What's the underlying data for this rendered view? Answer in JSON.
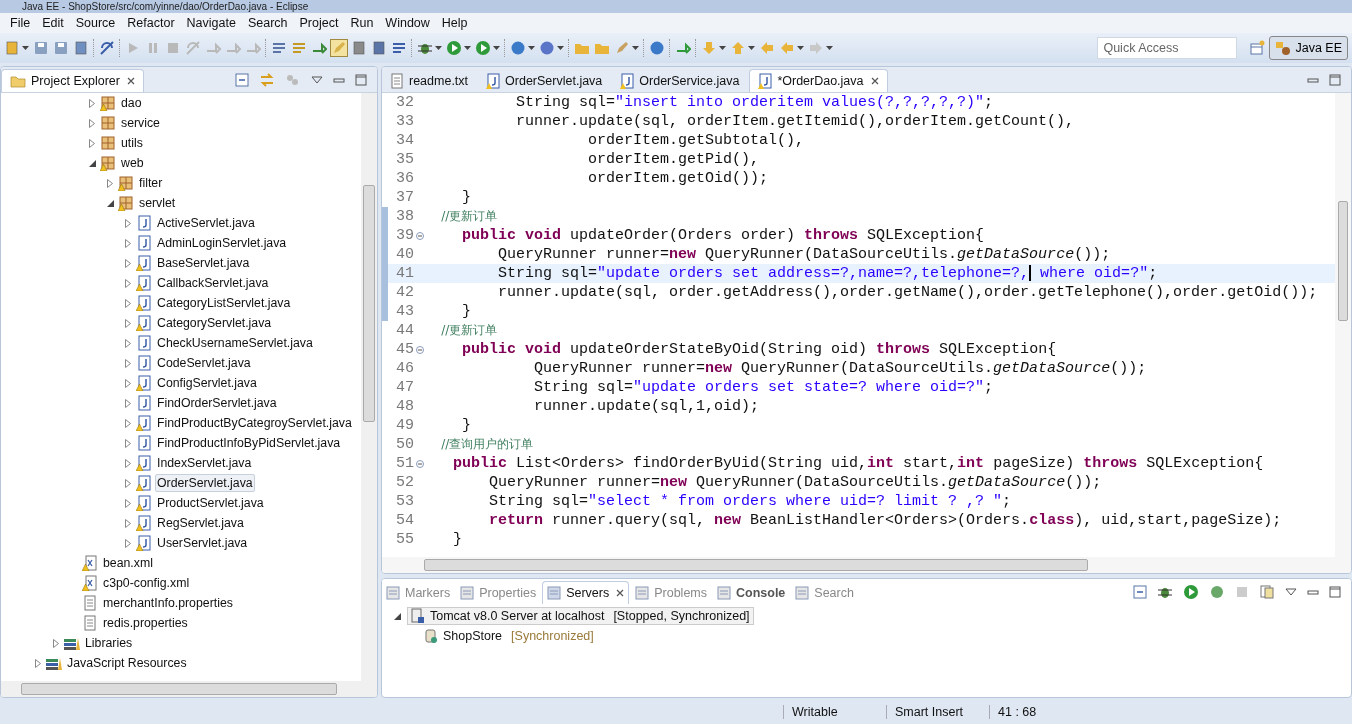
{
  "window": {
    "title": "Java EE - ShopStore/src/com/yinne/dao/OrderDao.java - Eclipse"
  },
  "menu": [
    "File",
    "Edit",
    "Source",
    "Refactor",
    "Navigate",
    "Search",
    "Project",
    "Run",
    "Window",
    "Help"
  ],
  "quick_access": {
    "placeholder": "Quick Access"
  },
  "perspective": {
    "label": "Java EE",
    "selected": true
  },
  "explorer": {
    "title": "Project Explorer",
    "tree": [
      {
        "children": [
          {
            "children": [
              {
                "children": [
                  {
                    "label": "dao",
                    "kind": "package",
                    "warning": true,
                    "expanded": false,
                    "selected": false
                  },
                  {
                    "label": "service",
                    "kind": "package",
                    "warning": false,
                    "expanded": false,
                    "selected": false
                  },
                  {
                    "label": "utils",
                    "kind": "package",
                    "warning": false,
                    "expanded": false,
                    "selected": false
                  },
                  {
                    "label": "web",
                    "kind": "package",
                    "warning": true,
                    "expanded": true,
                    "selected": false,
                    "children": [
                      {
                        "label": "filter",
                        "kind": "package",
                        "warning": true,
                        "expanded": false,
                        "selected": false
                      },
                      {
                        "label": "servlet",
                        "kind": "package",
                        "warning": true,
                        "expanded": true,
                        "selected": false,
                        "children": [
                          {
                            "label": "ActiveServlet.java",
                            "kind": "java",
                            "warning": false,
                            "expanded": false,
                            "selected": false
                          },
                          {
                            "label": "AdminLoginServlet.java",
                            "kind": "java",
                            "warning": false,
                            "expanded": false,
                            "selected": false
                          },
                          {
                            "label": "BaseServlet.java",
                            "kind": "java",
                            "warning": true,
                            "expanded": false,
                            "selected": false
                          },
                          {
                            "label": "CallbackServlet.java",
                            "kind": "java",
                            "warning": true,
                            "expanded": false,
                            "selected": false
                          },
                          {
                            "label": "CategoryListServlet.java",
                            "kind": "java",
                            "warning": true,
                            "expanded": false,
                            "selected": false
                          },
                          {
                            "label": "CategoryServlet.java",
                            "kind": "java",
                            "warning": true,
                            "expanded": false,
                            "selected": false
                          },
                          {
                            "label": "CheckUsernameServlet.java",
                            "kind": "java",
                            "warning": false,
                            "expanded": false,
                            "selected": false
                          },
                          {
                            "label": "CodeServlet.java",
                            "kind": "java",
                            "warning": false,
                            "expanded": false,
                            "selected": false
                          },
                          {
                            "label": "ConfigServlet.java",
                            "kind": "java",
                            "warning": true,
                            "expanded": false,
                            "selected": false
                          },
                          {
                            "label": "FindOrderServlet.java",
                            "kind": "java",
                            "warning": false,
                            "expanded": false,
                            "selected": false
                          },
                          {
                            "label": "FindProductByCategroyServlet.java",
                            "kind": "java",
                            "warning": true,
                            "expanded": false,
                            "selected": false
                          },
                          {
                            "label": "FindProductInfoByPidServlet.java",
                            "kind": "java",
                            "warning": false,
                            "expanded": false,
                            "selected": false
                          },
                          {
                            "label": "IndexServlet.java",
                            "kind": "java",
                            "warning": true,
                            "expanded": false,
                            "selected": false
                          },
                          {
                            "label": "OrderServlet.java",
                            "kind": "java",
                            "warning": true,
                            "expanded": false,
                            "selected": true
                          },
                          {
                            "label": "ProductServlet.java",
                            "kind": "java",
                            "warning": true,
                            "expanded": false,
                            "selected": false
                          },
                          {
                            "label": "RegServlet.java",
                            "kind": "java",
                            "warning": true,
                            "expanded": false,
                            "selected": false
                          },
                          {
                            "label": "UserServlet.java",
                            "kind": "java",
                            "warning": true,
                            "expanded": false,
                            "selected": false
                          }
                        ]
                      }
                    ]
                  }
                ]
              },
              {
                "label": "bean.xml",
                "kind": "xml",
                "warning": true,
                "selected": false
              },
              {
                "label": "c3p0-config.xml",
                "kind": "xml",
                "warning": true,
                "selected": false
              },
              {
                "label": "merchantInfo.properties",
                "kind": "file",
                "warning": false,
                "selected": false
              },
              {
                "label": "redis.properties",
                "kind": "file",
                "warning": false,
                "selected": false
              }
            ]
          },
          {
            "label": "Libraries",
            "kind": "library",
            "warning": false,
            "expanded": false,
            "selected": false
          }
        ]
      },
      {
        "label": "JavaScript Resources",
        "kind": "library",
        "warning": false,
        "expanded": false,
        "selected": false
      }
    ]
  },
  "editor_tabs": [
    {
      "label": "readme.txt",
      "kind": "text",
      "selected": false
    },
    {
      "label": "OrderServlet.java",
      "kind": "java",
      "selected": false
    },
    {
      "label": "OrderService.java",
      "kind": "java",
      "selected": false
    },
    {
      "label": "*OrderDao.java",
      "kind": "java",
      "selected": true
    }
  ],
  "code": [
    {
      "number": "32",
      "changed": false,
      "fold": false,
      "current": false,
      "tokens": [
        {
          "kind": "plain",
          "text": "          String sql="
        },
        {
          "kind": "str",
          "text": "\"insert into orderitem values(?,?,?,?,?)\""
        },
        {
          "kind": "plain",
          "text": ";"
        }
      ]
    },
    {
      "number": "33",
      "changed": false,
      "fold": false,
      "current": false,
      "tokens": [
        {
          "kind": "plain",
          "text": "          runner.update(sql, orderItem.getItemid(),orderItem.getCount(),"
        }
      ]
    },
    {
      "number": "34",
      "changed": false,
      "fold": false,
      "current": false,
      "tokens": [
        {
          "kind": "plain",
          "text": "                  orderItem.getSubtotal(),"
        }
      ]
    },
    {
      "number": "35",
      "changed": false,
      "fold": false,
      "current": false,
      "tokens": [
        {
          "kind": "plain",
          "text": "                  orderItem.getPid(),"
        }
      ]
    },
    {
      "number": "36",
      "changed": false,
      "fold": false,
      "current": false,
      "tokens": [
        {
          "kind": "plain",
          "text": "                  orderItem.getOid());"
        }
      ]
    },
    {
      "number": "37",
      "changed": false,
      "fold": false,
      "current": false,
      "tokens": [
        {
          "kind": "plain",
          "text": "    }"
        }
      ]
    },
    {
      "number": "38",
      "changed": true,
      "fold": false,
      "current": false,
      "tokens": [
        {
          "kind": "cmt",
          "text": "    //更新订单"
        }
      ]
    },
    {
      "number": "39",
      "changed": true,
      "fold": true,
      "current": false,
      "tokens": [
        {
          "kind": "kw",
          "text": "    public void"
        },
        {
          "kind": "plain",
          "text": " updateOrder(Orders order) "
        },
        {
          "kind": "kw",
          "text": "throws"
        },
        {
          "kind": "plain",
          "text": " SQLException{"
        }
      ]
    },
    {
      "number": "40",
      "changed": true,
      "fold": false,
      "current": false,
      "tokens": [
        {
          "kind": "plain",
          "text": "        QueryRunner runner="
        },
        {
          "kind": "kw",
          "text": "new"
        },
        {
          "kind": "plain",
          "text": " QueryRunner(DataSourceUtils."
        },
        {
          "kind": "it",
          "text": "getDataSource"
        },
        {
          "kind": "plain",
          "text": "());"
        }
      ]
    },
    {
      "number": "41",
      "changed": true,
      "fold": false,
      "current": true,
      "tokens": [
        {
          "kind": "plain",
          "text": "        String sql="
        },
        {
          "kind": "str",
          "text": "\"update orders set address=?,name=?,telephone=?,",
          "caret": true
        },
        {
          "kind": "str",
          "text": " where oid=?\""
        },
        {
          "kind": "plain",
          "text": ";"
        }
      ]
    },
    {
      "number": "42",
      "changed": true,
      "fold": false,
      "current": false,
      "tokens": [
        {
          "kind": "plain",
          "text": "        runner.update(sql, order.getAddress(),order.getName(),order.getTelephone(),order.getOid());"
        }
      ]
    },
    {
      "number": "43",
      "changed": true,
      "fold": false,
      "current": false,
      "tokens": [
        {
          "kind": "plain",
          "text": "    }"
        }
      ]
    },
    {
      "number": "44",
      "changed": false,
      "fold": false,
      "current": false,
      "tokens": [
        {
          "kind": "cmt",
          "text": "    //更新订单"
        }
      ]
    },
    {
      "number": "45",
      "changed": false,
      "fold": true,
      "current": false,
      "tokens": [
        {
          "kind": "kw",
          "text": "    public void"
        },
        {
          "kind": "plain",
          "text": " updateOrderStateByOid(String oid) "
        },
        {
          "kind": "kw",
          "text": "throws"
        },
        {
          "kind": "plain",
          "text": " SQLException{"
        }
      ]
    },
    {
      "number": "46",
      "changed": false,
      "fold": false,
      "current": false,
      "tokens": [
        {
          "kind": "plain",
          "text": "            QueryRunner runner="
        },
        {
          "kind": "kw",
          "text": "new"
        },
        {
          "kind": "plain",
          "text": " QueryRunner(DataSourceUtils."
        },
        {
          "kind": "it",
          "text": "getDataSource"
        },
        {
          "kind": "plain",
          "text": "());"
        }
      ]
    },
    {
      "number": "47",
      "changed": false,
      "fold": false,
      "current": false,
      "tokens": [
        {
          "kind": "plain",
          "text": "            String sql="
        },
        {
          "kind": "str",
          "text": "\"update orders set state=? where oid=?\""
        },
        {
          "kind": "plain",
          "text": ";"
        }
      ]
    },
    {
      "number": "48",
      "changed": false,
      "fold": false,
      "current": false,
      "tokens": [
        {
          "kind": "plain",
          "text": "            runner.update(sql,1,oid);"
        }
      ]
    },
    {
      "number": "49",
      "changed": false,
      "fold": false,
      "current": false,
      "tokens": [
        {
          "kind": "plain",
          "text": "    }"
        }
      ]
    },
    {
      "number": "50",
      "changed": false,
      "fold": false,
      "current": false,
      "tokens": [
        {
          "kind": "cmt",
          "text": "    //查询用户的订单"
        }
      ]
    },
    {
      "number": "51",
      "changed": false,
      "fold": true,
      "current": false,
      "tokens": [
        {
          "kind": "kw",
          "text": "   public"
        },
        {
          "kind": "plain",
          "text": " List<Orders> findOrderByUid(String uid,"
        },
        {
          "kind": "kw",
          "text": "int"
        },
        {
          "kind": "plain",
          "text": " start,"
        },
        {
          "kind": "kw",
          "text": "int"
        },
        {
          "kind": "plain",
          "text": " pageSize) "
        },
        {
          "kind": "kw",
          "text": "throws"
        },
        {
          "kind": "plain",
          "text": " SQLException{"
        }
      ]
    },
    {
      "number": "52",
      "changed": false,
      "fold": false,
      "current": false,
      "tokens": [
        {
          "kind": "plain",
          "text": "       QueryRunner runner="
        },
        {
          "kind": "kw",
          "text": "new"
        },
        {
          "kind": "plain",
          "text": " QueryRunner(DataSourceUtils."
        },
        {
          "kind": "it",
          "text": "getDataSource"
        },
        {
          "kind": "plain",
          "text": "());"
        }
      ]
    },
    {
      "number": "53",
      "changed": false,
      "fold": false,
      "current": false,
      "tokens": [
        {
          "kind": "plain",
          "text": "       String sql="
        },
        {
          "kind": "str",
          "text": "\"select * from orders where uid=? limit ? ,? \""
        },
        {
          "kind": "plain",
          "text": ";"
        }
      ]
    },
    {
      "number": "54",
      "changed": false,
      "fold": false,
      "current": false,
      "tokens": [
        {
          "kind": "kw",
          "text": "       return"
        },
        {
          "kind": "plain",
          "text": " runner.query(sql, "
        },
        {
          "kind": "kw",
          "text": "new"
        },
        {
          "kind": "plain",
          "text": " BeanListHandler<Orders>(Orders."
        },
        {
          "kind": "kw",
          "text": "class"
        },
        {
          "kind": "plain",
          "text": "), uid,start,pageSize);"
        }
      ]
    },
    {
      "number": "55",
      "changed": false,
      "fold": false,
      "current": false,
      "tokens": [
        {
          "kind": "plain",
          "text": "   }"
        }
      ]
    }
  ],
  "bottom_tabs": [
    {
      "label": "Markers",
      "selected": false,
      "bold": false
    },
    {
      "label": "Properties",
      "selected": false,
      "bold": false
    },
    {
      "label": "Servers",
      "selected": true,
      "bold": false
    },
    {
      "label": "Problems",
      "selected": false,
      "bold": false
    },
    {
      "label": "Console",
      "selected": false,
      "bold": true
    },
    {
      "label": "Search",
      "selected": false,
      "bold": false
    }
  ],
  "servers": [
    {
      "name": "Tomcat v8.0 Server at localhost",
      "status": "[Stopped, Synchronized]",
      "expanded": true,
      "selected": true,
      "children": [
        {
          "name": "ShopStore",
          "status": "[Synchronized]",
          "selected": false
        }
      ]
    }
  ],
  "status_bar": [
    "Writable",
    "Smart Insert",
    "41 : 68"
  ]
}
